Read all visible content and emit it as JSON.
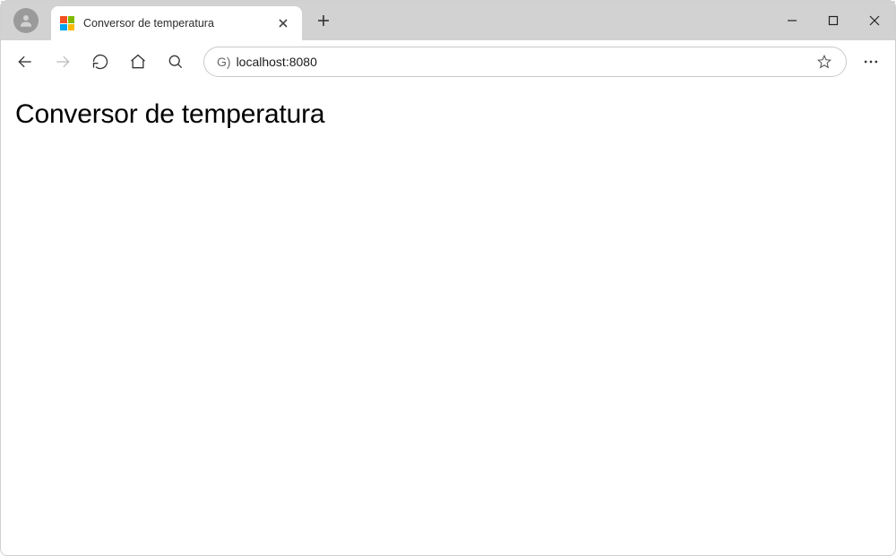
{
  "tab": {
    "title": "Conversor de temperatura"
  },
  "addressbar": {
    "prefix": "G)",
    "url": "localhost:8080"
  },
  "page": {
    "heading": "Conversor de temperatura"
  }
}
